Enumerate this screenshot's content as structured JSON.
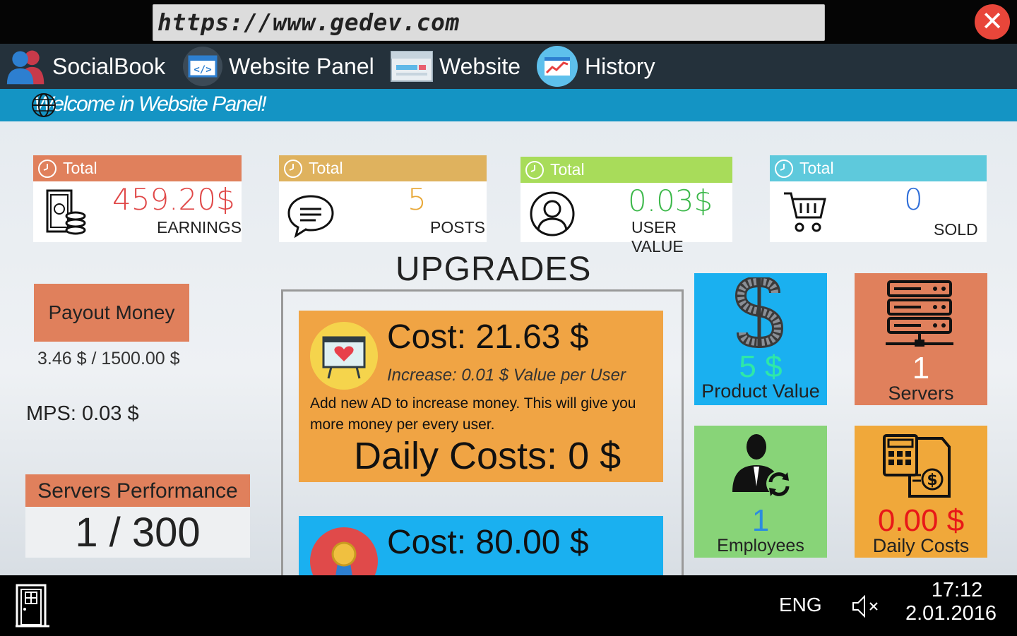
{
  "browser": {
    "url": "https://www.gedev.com",
    "close_symbol": "✕"
  },
  "nav": {
    "items": [
      {
        "label": "SocialBook",
        "icon": "people-icon"
      },
      {
        "label": "Website Panel",
        "icon": "code-window-icon"
      },
      {
        "label": "Website",
        "icon": "browser-window-icon"
      },
      {
        "label": "History",
        "icon": "trend-chart-icon"
      }
    ]
  },
  "banner": {
    "text": "Welcome in Website Panel!"
  },
  "stats": [
    {
      "header": "Total",
      "value": "459.20$",
      "caption": "EARNINGS",
      "color": "#e0805c",
      "value_color": "#e04848",
      "icon": "money-stack-icon"
    },
    {
      "header": "Total",
      "value": "5",
      "caption": "POSTS",
      "color": "#dfb25e",
      "value_color": "#e8a838",
      "icon": "chat-bubble-icon"
    },
    {
      "header": "Total",
      "value": "0.03$",
      "caption": "USER VALUE",
      "color": "#a8dc5a",
      "value_color": "#3cb84a",
      "icon": "user-circle-icon"
    },
    {
      "header": "Total",
      "value": "0",
      "caption": "SOLD",
      "color": "#5ec9dc",
      "value_color": "#2c6cd8",
      "icon": "shopping-cart-icon"
    }
  ],
  "left": {
    "payout_label": "Payout Money",
    "payout_progress": "3.46 $ / 1500.00 $",
    "mps": "MPS: 0.03 $",
    "perf_label": "Servers Performance",
    "perf_value": "1 / 300"
  },
  "upgrades": {
    "title": "UPGRADES",
    "cards": [
      {
        "cost": "Cost: 21.63 $",
        "increase": "Increase: 0.01 $ Value per User",
        "description": "Add new AD to increase money. This will give you more money per every user.",
        "daily": "Daily Costs: 0 $",
        "color": "#f0a444",
        "icon": "billboard-heart-icon"
      },
      {
        "cost": "Cost: 80.00 $",
        "color": "#1ab0f0",
        "icon": "award-ribbon-icon"
      }
    ]
  },
  "tiles": [
    {
      "value": "5 $",
      "caption": "Product Value",
      "color": "#1ab0f0",
      "value_color": "#2ee8a8",
      "icon": "dollar-conveyor-icon"
    },
    {
      "value": "1",
      "caption": "Servers",
      "color": "#e0805c",
      "value_color": "#ffffff",
      "icon": "server-rack-icon"
    },
    {
      "value": "1",
      "caption": "Employees",
      "color": "#88d478",
      "value_color": "#2c8ce0",
      "icon": "employee-refresh-icon"
    },
    {
      "value": "0.00 $",
      "caption": "Daily Costs",
      "color": "#f0a83a",
      "value_color": "#e81818",
      "icon": "calculator-invoice-icon"
    }
  ],
  "taskbar": {
    "language": "ENG",
    "time": "17:12",
    "date": "2.01.2016",
    "icons": [
      "door-exit-icon",
      "speaker-muted-icon"
    ]
  }
}
